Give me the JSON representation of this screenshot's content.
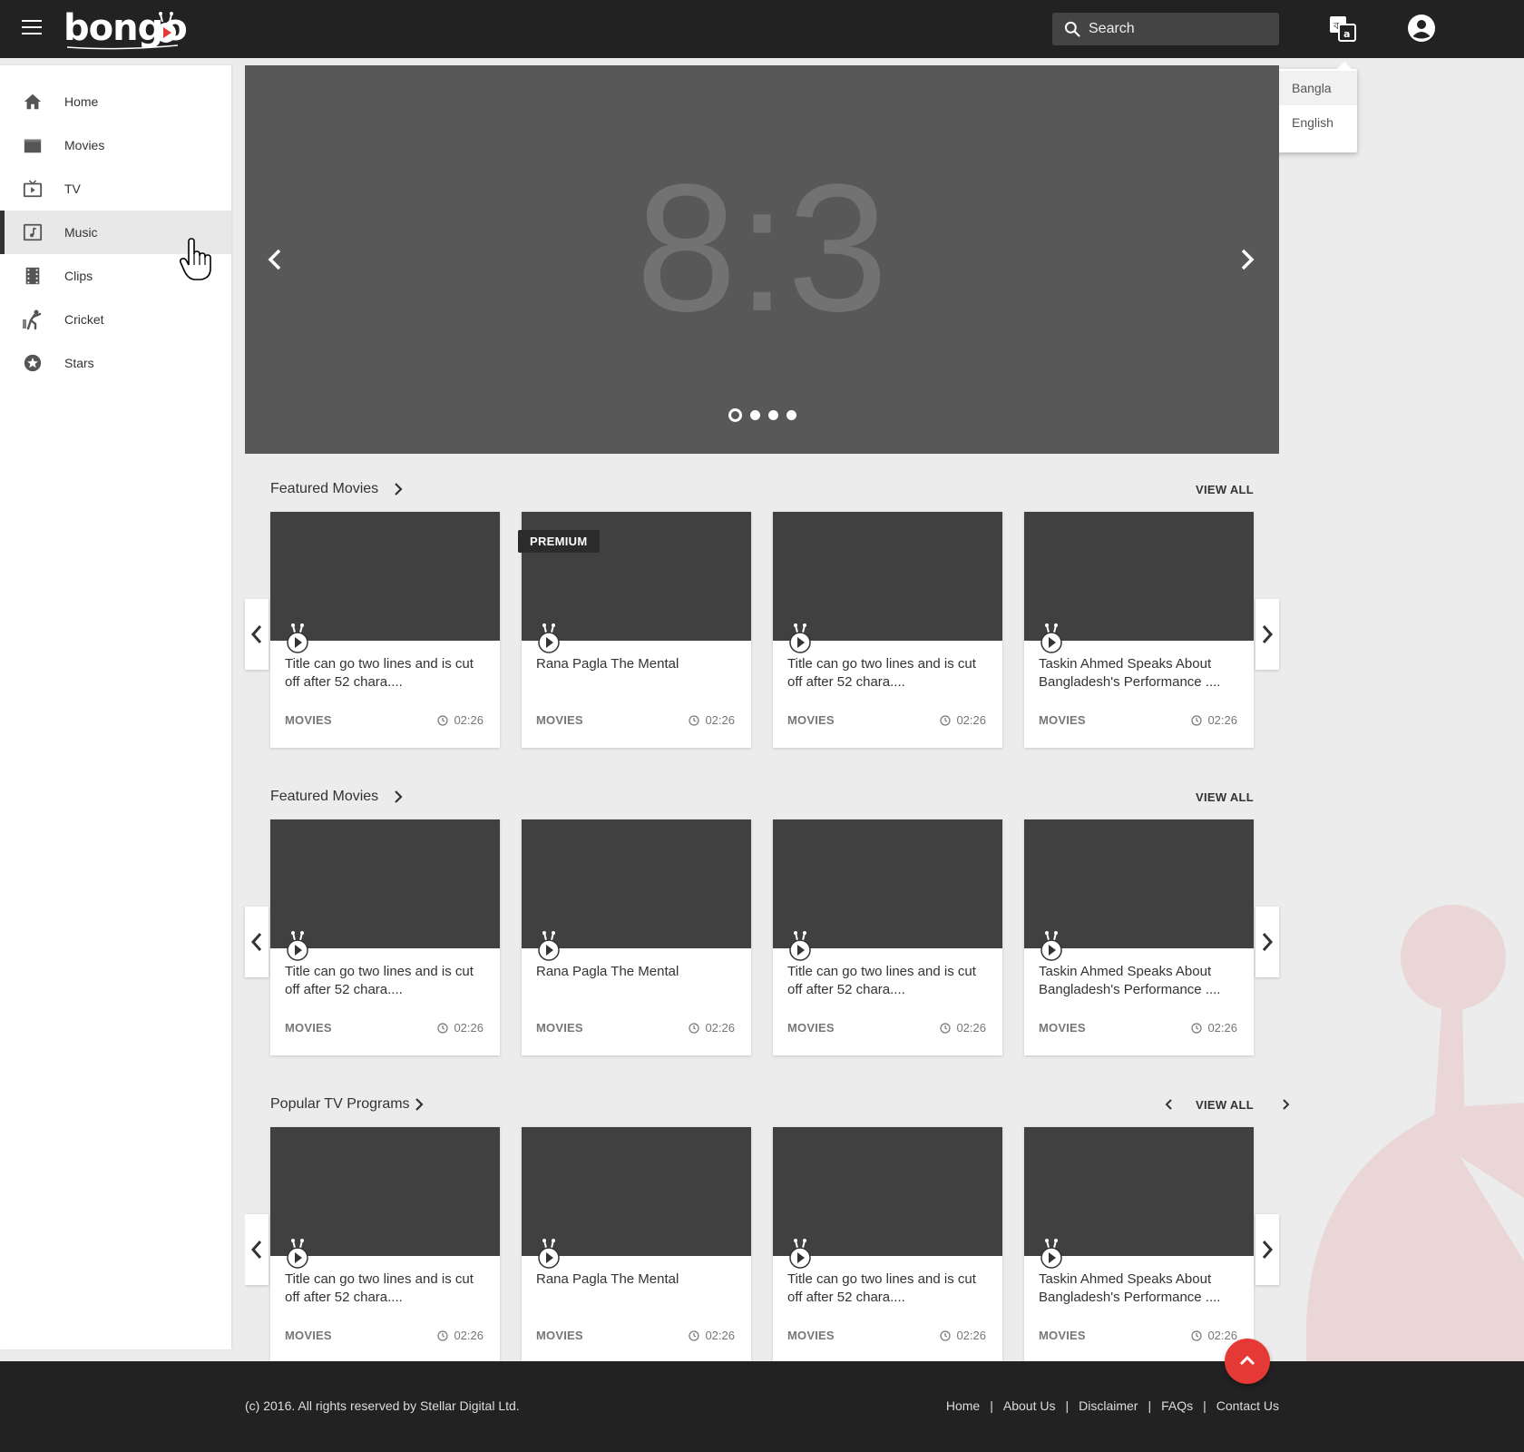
{
  "header": {
    "logo": "bongo",
    "search_placeholder": "Search"
  },
  "language_menu": {
    "options": [
      {
        "label": "Bangla",
        "selected": true
      },
      {
        "label": "English",
        "selected": false
      }
    ]
  },
  "sidebar": {
    "items": [
      {
        "label": "Home",
        "icon": "home-icon",
        "active": false
      },
      {
        "label": "Movies",
        "icon": "movie-icon",
        "active": false
      },
      {
        "label": "TV",
        "icon": "tv-icon",
        "active": false
      },
      {
        "label": "Music",
        "icon": "music-icon",
        "active": true
      },
      {
        "label": "Clips",
        "icon": "clips-icon",
        "active": false
      },
      {
        "label": "Cricket",
        "icon": "cricket-icon",
        "active": false
      },
      {
        "label": "Stars",
        "icon": "star-icon",
        "active": false
      }
    ]
  },
  "hero": {
    "placeholder_text": "8:3",
    "slide_count": 4,
    "active_slide": 1
  },
  "sections": [
    {
      "title": "Featured Movies",
      "view_all": "VIEW ALL",
      "cards": [
        {
          "title": "Title can go two lines and is cut off after 52 chara....",
          "category": "MOVIES",
          "duration": "02:26",
          "badge": ""
        },
        {
          "title": "Rana Pagla The Mental",
          "category": "MOVIES",
          "duration": "02:26",
          "badge": "PREMIUM"
        },
        {
          "title": "Title can go two lines and is cut off after 52 chara....",
          "category": "MOVIES",
          "duration": "02:26",
          "badge": ""
        },
        {
          "title": "Taskin Ahmed Speaks About Bangladesh's Performance ....",
          "category": "MOVIES",
          "duration": "02:26",
          "badge": ""
        }
      ]
    },
    {
      "title": "Featured Movies",
      "view_all": "VIEW ALL",
      "cards": [
        {
          "title": "Title can go two lines and is cut off after 52 chara....",
          "category": "MOVIES",
          "duration": "02:26",
          "badge": ""
        },
        {
          "title": "Rana Pagla The Mental",
          "category": "MOVIES",
          "duration": "02:26",
          "badge": ""
        },
        {
          "title": "Title can go two lines and is cut off after 52 chara....",
          "category": "MOVIES",
          "duration": "02:26",
          "badge": ""
        },
        {
          "title": "Taskin Ahmed Speaks About Bangladesh's Performance ....",
          "category": "MOVIES",
          "duration": "02:26",
          "badge": ""
        }
      ]
    },
    {
      "title": "Popular TV Programs",
      "view_all": "VIEW ALL",
      "cards": [
        {
          "title": "Title can go two lines and is cut off after 52 chara....",
          "category": "MOVIES",
          "duration": "02:26",
          "badge": ""
        },
        {
          "title": "Rana Pagla The Mental",
          "category": "MOVIES",
          "duration": "02:26",
          "badge": ""
        },
        {
          "title": "Title can go two lines and is cut off after 52 chara....",
          "category": "MOVIES",
          "duration": "02:26",
          "badge": ""
        },
        {
          "title": "Taskin Ahmed Speaks About Bangladesh's Performance ....",
          "category": "MOVIES",
          "duration": "02:26",
          "badge": ""
        }
      ]
    }
  ],
  "footer": {
    "copyright": "(c) 2016. All rights reserved by Stellar Digital Ltd.",
    "links": [
      "Home",
      "About Us",
      "Disclaimer",
      "FAQs",
      "Contact Us"
    ]
  },
  "colors": {
    "topbar": "#222222",
    "accent": "#e53935",
    "thumb": "#404040",
    "hero": "#585858"
  }
}
